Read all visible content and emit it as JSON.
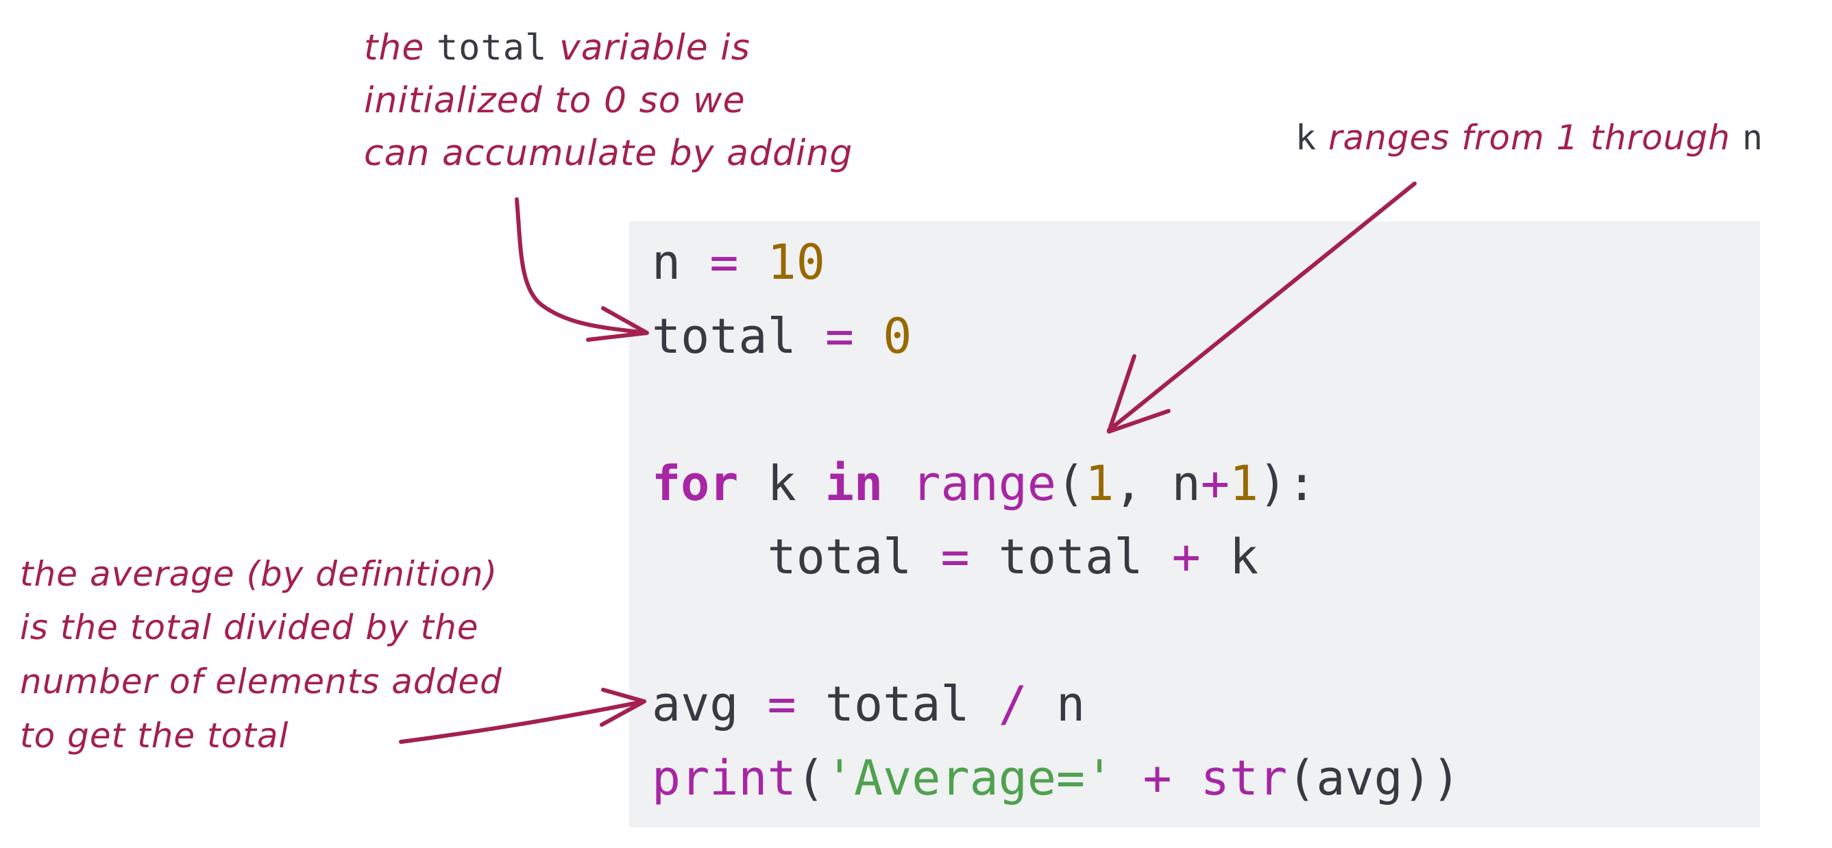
{
  "colors": {
    "annotation": "#a3204f",
    "code_background": "#f0f1f3",
    "code_text": "#383a42",
    "keyword": "#a626a4",
    "number": "#986801",
    "string": "#50a14f"
  },
  "code": {
    "language": "python",
    "lines": [
      {
        "tokens": [
          {
            "type": "id",
            "text": "n"
          },
          {
            "type": "ws",
            "text": " "
          },
          {
            "type": "op",
            "text": "="
          },
          {
            "type": "ws",
            "text": " "
          },
          {
            "type": "num",
            "text": "10"
          }
        ]
      },
      {
        "tokens": [
          {
            "type": "id",
            "text": "total"
          },
          {
            "type": "ws",
            "text": " "
          },
          {
            "type": "op",
            "text": "="
          },
          {
            "type": "ws",
            "text": " "
          },
          {
            "type": "num",
            "text": "0"
          }
        ]
      },
      {
        "tokens": []
      },
      {
        "tokens": [
          {
            "type": "kw",
            "text": "for"
          },
          {
            "type": "ws",
            "text": " "
          },
          {
            "type": "id",
            "text": "k"
          },
          {
            "type": "ws",
            "text": " "
          },
          {
            "type": "kw",
            "text": "in"
          },
          {
            "type": "ws",
            "text": " "
          },
          {
            "type": "fn",
            "text": "range"
          },
          {
            "type": "id",
            "text": "("
          },
          {
            "type": "num",
            "text": "1"
          },
          {
            "type": "id",
            "text": ", n"
          },
          {
            "type": "op",
            "text": "+"
          },
          {
            "type": "num",
            "text": "1"
          },
          {
            "type": "id",
            "text": "):"
          }
        ]
      },
      {
        "tokens": [
          {
            "type": "ws",
            "text": "    "
          },
          {
            "type": "id",
            "text": "total"
          },
          {
            "type": "ws",
            "text": " "
          },
          {
            "type": "op",
            "text": "="
          },
          {
            "type": "ws",
            "text": " "
          },
          {
            "type": "id",
            "text": "total"
          },
          {
            "type": "ws",
            "text": " "
          },
          {
            "type": "op",
            "text": "+"
          },
          {
            "type": "ws",
            "text": " "
          },
          {
            "type": "id",
            "text": "k"
          }
        ]
      },
      {
        "tokens": []
      },
      {
        "tokens": [
          {
            "type": "id",
            "text": "avg"
          },
          {
            "type": "ws",
            "text": " "
          },
          {
            "type": "op",
            "text": "="
          },
          {
            "type": "ws",
            "text": " "
          },
          {
            "type": "id",
            "text": "total"
          },
          {
            "type": "ws",
            "text": " "
          },
          {
            "type": "op",
            "text": "/"
          },
          {
            "type": "ws",
            "text": " "
          },
          {
            "type": "id",
            "text": "n"
          }
        ]
      },
      {
        "tokens": [
          {
            "type": "fn",
            "text": "print"
          },
          {
            "type": "id",
            "text": "("
          },
          {
            "type": "str",
            "text": "'Average='"
          },
          {
            "type": "ws",
            "text": " "
          },
          {
            "type": "op",
            "text": "+"
          },
          {
            "type": "ws",
            "text": " "
          },
          {
            "type": "fn",
            "text": "str"
          },
          {
            "type": "id",
            "text": "(avg))"
          }
        ]
      }
    ]
  },
  "annotations": {
    "total_init": {
      "line1_pre": "the ",
      "line1_code": "total",
      "line1_post": " variable is",
      "line2": "initialized to 0 so we",
      "line3": "can accumulate by adding",
      "points_to": "total = 0"
    },
    "k_range": {
      "code_k": "k",
      "text": " ranges from 1 through ",
      "code_n": "n",
      "points_to": "range(1, n+1)"
    },
    "average": {
      "line1": "the average (by definition)",
      "line2": "is the total divided by the",
      "line3": "number of elements added",
      "line4": "to get the total",
      "points_to": "avg = total / n"
    }
  }
}
